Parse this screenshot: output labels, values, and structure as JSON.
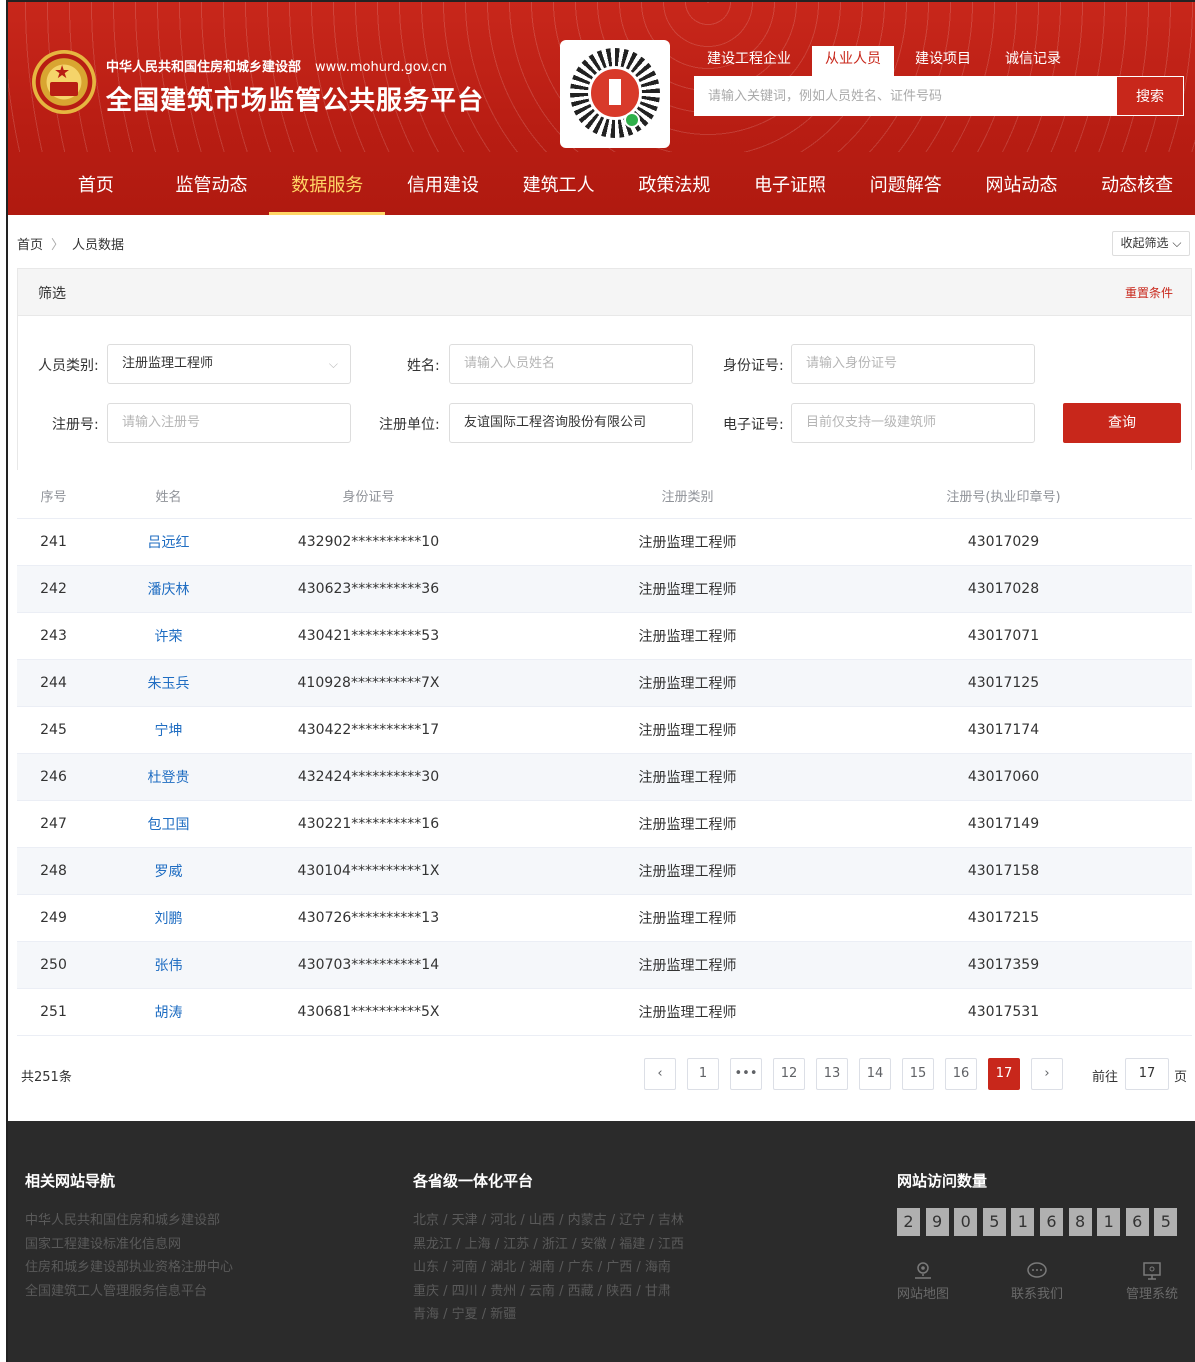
{
  "header": {
    "subtitle": "中华人民共和国住房和城乡建设部",
    "url": "www.mohurd.gov.cn",
    "title": "全国建筑市场监管公共服务平台",
    "search_tabs": [
      "建设工程企业",
      "从业人员",
      "建设项目",
      "诚信记录"
    ],
    "active_search_tab": "从业人员",
    "search_placeholder": "请输入关键词，例如人员姓名、证件号码",
    "search_button": "搜索"
  },
  "nav": {
    "items": [
      "首页",
      "监管动态",
      "数据服务",
      "信用建设",
      "建筑工人",
      "政策法规",
      "电子证照",
      "问题解答",
      "网站动态",
      "动态核查"
    ],
    "active": "数据服务"
  },
  "breadcrumb": {
    "home": "首页",
    "current": "人员数据"
  },
  "collapse_filter": "收起筛选",
  "filter": {
    "title": "筛选",
    "reset": "重置条件",
    "person_type_label": "人员类别:",
    "person_type_value": "注册监理工程师",
    "name_label": "姓名:",
    "name_placeholder": "请输入人员姓名",
    "id_label": "身份证号:",
    "id_placeholder": "请输入身份证号",
    "reg_no_label": "注册号:",
    "reg_no_placeholder": "请输入注册号",
    "unit_label": "注册单位:",
    "unit_value": "友谊国际工程咨询股份有限公司",
    "ecert_label": "电子证号:",
    "ecert_placeholder": "目前仅支持一级建筑师",
    "query_button": "查询"
  },
  "table": {
    "headers": [
      "序号",
      "姓名",
      "身份证号",
      "注册类别",
      "注册号(执业印章号)"
    ],
    "rows": [
      [
        "241",
        "吕远红",
        "432902**********10",
        "注册监理工程师",
        "43017029"
      ],
      [
        "242",
        "潘庆林",
        "430623**********36",
        "注册监理工程师",
        "43017028"
      ],
      [
        "243",
        "许荣",
        "430421**********53",
        "注册监理工程师",
        "43017071"
      ],
      [
        "244",
        "朱玉兵",
        "410928**********7X",
        "注册监理工程师",
        "43017125"
      ],
      [
        "245",
        "宁坤",
        "430422**********17",
        "注册监理工程师",
        "43017174"
      ],
      [
        "246",
        "杜登贵",
        "432424**********30",
        "注册监理工程师",
        "43017060"
      ],
      [
        "247",
        "包卫国",
        "430221**********16",
        "注册监理工程师",
        "43017149"
      ],
      [
        "248",
        "罗威",
        "430104**********1X",
        "注册监理工程师",
        "43017158"
      ],
      [
        "249",
        "刘鹏",
        "430726**********13",
        "注册监理工程师",
        "43017215"
      ],
      [
        "250",
        "张伟",
        "430703**********14",
        "注册监理工程师",
        "43017359"
      ],
      [
        "251",
        "胡涛",
        "430681**********5X",
        "注册监理工程师",
        "43017531"
      ]
    ]
  },
  "pagination": {
    "total": "共251条",
    "prev": "‹",
    "next": "›",
    "pages": [
      "1",
      "•••",
      "12",
      "13",
      "14",
      "15",
      "16",
      "17"
    ],
    "current": "17",
    "goto_label": "前往",
    "goto_value": "17",
    "page_unit": "页"
  },
  "footer": {
    "nav_title": "相关网站导航",
    "nav_links": [
      "中华人民共和国住房和城乡建设部",
      "国家工程建设标准化信息网",
      "住房和城乡建设部执业资格注册中心",
      "全国建筑工人管理服务信息平台"
    ],
    "provinces_title": "各省级一体化平台",
    "province_lines": [
      "北京 / 天津 / 河北 / 山西 / 内蒙古 / 辽宁 / 吉林",
      "黑龙江 / 上海 / 江苏 / 浙江 / 安徽 / 福建 / 江西",
      "山东 / 河南 / 湖北 / 湖南 / 广东 / 广西 / 海南",
      "重庆 / 四川 / 贵州 / 云南 / 西藏 / 陕西 / 甘肃",
      "青海 / 宁夏 / 新疆"
    ],
    "visits_title": "网站访问数量",
    "visit_digits": [
      "2",
      "9",
      "0",
      "5",
      "1",
      "6",
      "8",
      "1",
      "6",
      "5"
    ],
    "icons": [
      {
        "label": "网站地图",
        "icon": "map-pin-icon"
      },
      {
        "label": "联系我们",
        "icon": "chat-bubble-icon"
      },
      {
        "label": "管理系统",
        "icon": "monitor-icon"
      }
    ]
  },
  "colors": {
    "brand_red": "#c8271b",
    "active_nav": "#ffd666",
    "link_blue": "#1f6dc2",
    "footer_bg": "#2b2b2b"
  }
}
